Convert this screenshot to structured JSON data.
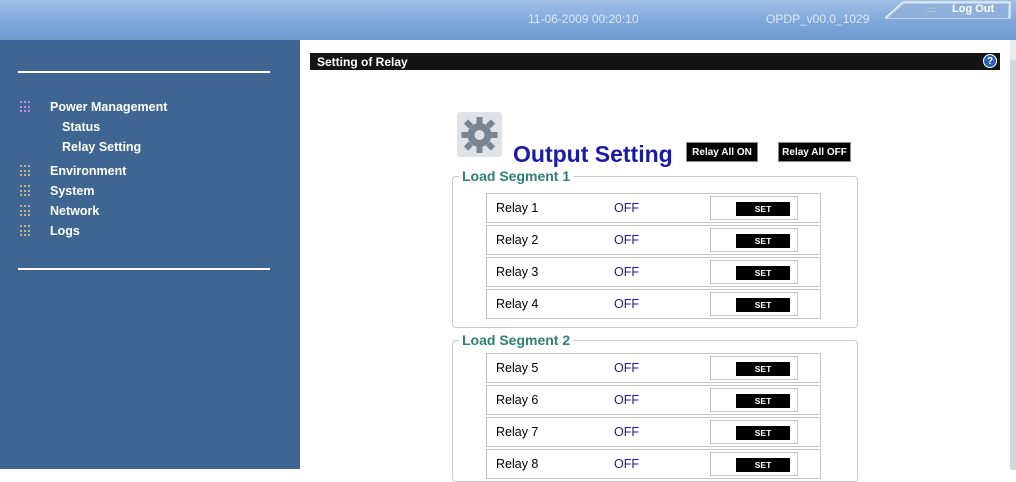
{
  "header": {
    "datetime": "11-06-2009 00:20:10",
    "version": "OPDP_v00.0_1029",
    "logout_label": "Log Out",
    "logout_dots": ":::::"
  },
  "sidebar": {
    "items": [
      {
        "label": "Power Management",
        "icon": "grid-dots-icon",
        "active": true
      },
      {
        "label": "Status"
      },
      {
        "label": "Relay Setting"
      },
      {
        "label": "Environment",
        "icon": "grid-dots-icon"
      },
      {
        "label": "System",
        "icon": "grid-dots-icon"
      },
      {
        "label": "Network",
        "icon": "grid-dots-icon"
      },
      {
        "label": "Logs",
        "icon": "grid-dots-icon"
      }
    ]
  },
  "page": {
    "title": "Setting of Relay",
    "help_icon": "help-icon",
    "help_glyph": "?"
  },
  "output": {
    "title": "Output Setting",
    "icon": "gear-icon",
    "all_on_label": "Relay All ON",
    "all_off_label": "Relay All OFF"
  },
  "segments": [
    {
      "label": "Load Segment 1",
      "relays": [
        {
          "name": "Relay  1",
          "status": "OFF",
          "button": "SET"
        },
        {
          "name": "Relay  2",
          "status": "OFF",
          "button": "SET"
        },
        {
          "name": "Relay  3",
          "status": "OFF",
          "button": "SET"
        },
        {
          "name": "Relay  4",
          "status": "OFF",
          "button": "SET"
        }
      ]
    },
    {
      "label": "Load Segment 2",
      "relays": [
        {
          "name": "Relay  5",
          "status": "OFF",
          "button": "SET"
        },
        {
          "name": "Relay  6",
          "status": "OFF",
          "button": "SET"
        },
        {
          "name": "Relay  7",
          "status": "OFF",
          "button": "SET"
        },
        {
          "name": "Relay  8",
          "status": "OFF",
          "button": "SET"
        }
      ]
    }
  ],
  "colors": {
    "sidebar_bg": "#3f6592",
    "header_bg": "#7ea8da",
    "title_blue": "#1a1aa8",
    "segment_green": "#2c8272"
  }
}
